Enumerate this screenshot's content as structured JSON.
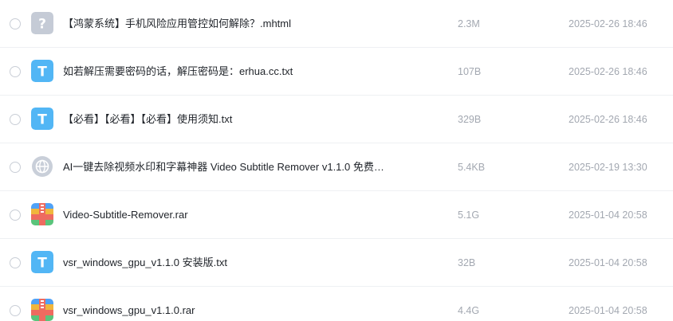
{
  "files": [
    {
      "name": "【鸿蒙系统】手机风险应用管控如何解除？.mhtml",
      "size": "2.3M",
      "date": "2025-02-26 18:46",
      "icon": "unknown-file-icon"
    },
    {
      "name": "如若解压需要密码的话，解压密码是：erhua.cc.txt",
      "size": "107B",
      "date": "2025-02-26 18:46",
      "icon": "text-file-icon"
    },
    {
      "name": "【必看】【必看】【必看】使用须知.txt",
      "size": "329B",
      "date": "2025-02-26 18:46",
      "icon": "text-file-icon"
    },
    {
      "name": "AI一键去除视频水印和字幕神器 Video Subtitle Remover v1.1.0 免费…",
      "size": "5.4KB",
      "date": "2025-02-19 13:30",
      "icon": "web-link-icon"
    },
    {
      "name": "Video-Subtitle-Remover.rar",
      "size": "5.1G",
      "date": "2025-01-04 20:58",
      "icon": "archive-file-icon"
    },
    {
      "name": "vsr_windows_gpu_v1.1.0 安装版.txt",
      "size": "32B",
      "date": "2025-01-04 20:58",
      "icon": "text-file-icon"
    },
    {
      "name": "vsr_windows_gpu_v1.1.0.rar",
      "size": "4.4G",
      "date": "2025-01-04 20:58",
      "icon": "archive-file-icon"
    }
  ],
  "colors": {
    "text_icon": "#52b6f5",
    "unknown_icon": "#c5cbd6",
    "web_icon": "#c9cfd9",
    "archive_stripes": [
      "#4fa2f7",
      "#f0b63d",
      "#ee6b60",
      "#5ac47b"
    ]
  }
}
